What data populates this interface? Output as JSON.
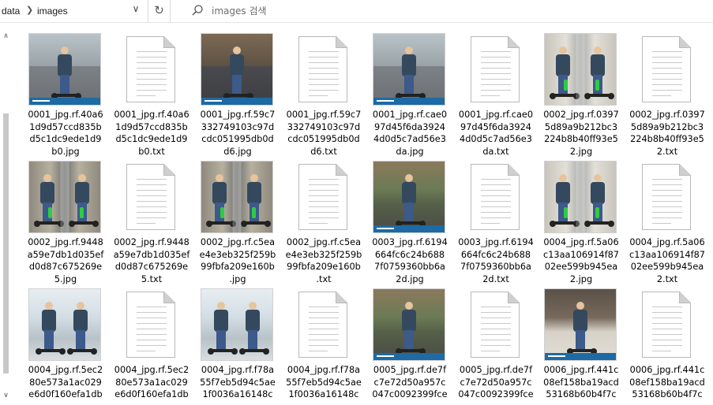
{
  "window": {
    "breadcrumb": [
      "data",
      "images"
    ],
    "search_placeholder": "images 검색"
  },
  "icons": {
    "breadcrumb_separator": "chevron-right-icon",
    "address_dropdown": "chevron-down-icon",
    "refresh": "refresh-icon",
    "search": "search-icon",
    "scroll_up": "scroll-up-arrow-icon",
    "scroll_down": "scroll-down-arrow-icon"
  },
  "files": [
    {
      "kind": "img",
      "art": "street",
      "lines": [
        "0001_jpg.rf.40a6",
        "1d9d57ccd835b",
        "d5c1dc9ede1d9",
        "b0.jpg"
      ]
    },
    {
      "kind": "txt",
      "lines": [
        "0001_jpg.rf.40a6",
        "1d9d57ccd835b",
        "d5c1dc9ede1d9",
        "b0.txt"
      ]
    },
    {
      "kind": "img",
      "art": "street-dark",
      "lines": [
        "0001_jpg.rf.59c7",
        "332749103c97d",
        "cdc051995db0d",
        "d6.jpg"
      ]
    },
    {
      "kind": "txt",
      "lines": [
        "0001_jpg.rf.59c7",
        "332749103c97d",
        "cdc051995db0d",
        "d6.txt"
      ]
    },
    {
      "kind": "img",
      "art": "street",
      "lines": [
        "0001_jpg.rf.cae0",
        "97d45f6da3924",
        "4d0d5c7ad56e3",
        "da.jpg"
      ]
    },
    {
      "kind": "txt",
      "lines": [
        "0001_jpg.rf.cae0",
        "97d45f6da3924",
        "4d0d5c7ad56e3",
        "da.txt"
      ]
    },
    {
      "kind": "img",
      "art": "mirror-light",
      "lines": [
        "0002_jpg.rf.0397",
        "5d89a9b212bc3",
        "224b8b40ff93e5",
        "2.jpg"
      ]
    },
    {
      "kind": "txt",
      "lines": [
        "0002_jpg.rf.0397",
        "5d89a9b212bc3",
        "224b8b40ff93e5",
        "2.txt"
      ]
    },
    {
      "kind": "img",
      "art": "mirror",
      "lines": [
        "0002_jpg.rf.9448",
        "a59e7db1d035ef",
        "d0d87c675269e",
        "5.jpg"
      ]
    },
    {
      "kind": "txt",
      "lines": [
        "0002_jpg.rf.9448",
        "a59e7db1d035ef",
        "d0d87c675269e",
        "5.txt"
      ]
    },
    {
      "kind": "img",
      "art": "mirror",
      "lines": [
        "0002_jpg.rf.c5ea",
        "e4e3eb325f259b",
        "99fbfa209e160b",
        ".jpg"
      ]
    },
    {
      "kind": "txt",
      "lines": [
        "0002_jpg.rf.c5ea",
        "e4e3eb325f259b",
        "99fbfa209e160b",
        ".txt"
      ]
    },
    {
      "kind": "img",
      "art": "park",
      "lines": [
        "0003_jpg.rf.6194",
        "664fc6c24b688",
        "7f0759360bb6a",
        "2d.jpg"
      ]
    },
    {
      "kind": "txt",
      "lines": [
        "0003_jpg.rf.6194",
        "664fc6c24b688",
        "7f0759360bb6a",
        "2d.txt"
      ]
    },
    {
      "kind": "img",
      "art": "mirror-light",
      "lines": [
        "0004_jpg.rf.5a06",
        "c13aa106914f87",
        "02ee599b945ea",
        "2.jpg"
      ]
    },
    {
      "kind": "txt",
      "lines": [
        "0004_jpg.rf.5a06",
        "c13aa106914f87",
        "02ee599b945ea",
        "2.txt"
      ]
    },
    {
      "kind": "img",
      "art": "bright",
      "lines": [
        "0004_jpg.rf.5ec2",
        "80e573a1ac029",
        "e6d0f160efa1db",
        ""
      ]
    },
    {
      "kind": "txt",
      "lines": [
        "0004_jpg.rf.5ec2",
        "80e573a1ac029",
        "e6d0f160efa1db",
        ""
      ]
    },
    {
      "kind": "img",
      "art": "bright",
      "lines": [
        "0004_jpg.rf.f78a",
        "55f7eb5d94c5ae",
        "1f0036a16148c",
        ""
      ]
    },
    {
      "kind": "txt",
      "lines": [
        "0004_jpg.rf.f78a",
        "55f7eb5d94c5ae",
        "1f0036a16148c",
        ""
      ]
    },
    {
      "kind": "img",
      "art": "park",
      "lines": [
        "0005_jpg.rf.de7f",
        "c7e72d50a957c",
        "047c0092399fce",
        ""
      ]
    },
    {
      "kind": "txt",
      "lines": [
        "0005_jpg.rf.de7f",
        "c7e72d50a957c",
        "047c0092399fce",
        ""
      ]
    },
    {
      "kind": "img",
      "art": "city",
      "lines": [
        "0006_jpg.rf.441c",
        "08ef158ba19acd",
        "53168b60b4f7c",
        ""
      ]
    },
    {
      "kind": "txt",
      "lines": [
        "0006_jpg.rf.441c",
        "08ef158ba19acd",
        "53168b60b4f7c",
        ""
      ]
    }
  ]
}
